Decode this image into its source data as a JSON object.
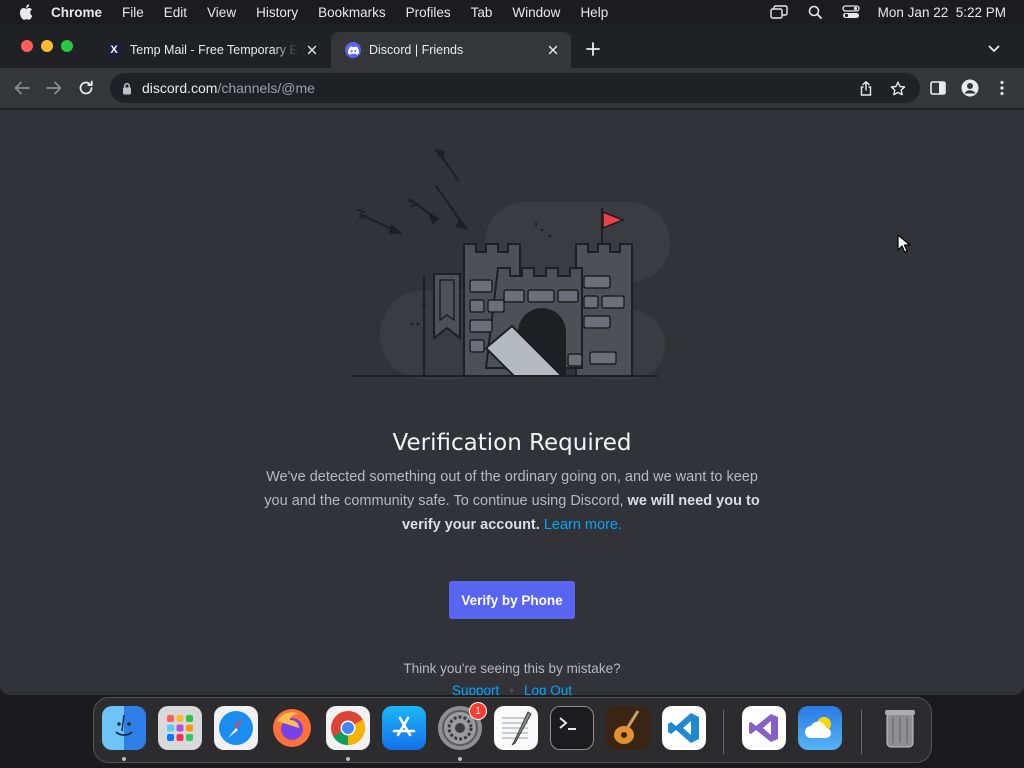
{
  "menubar": {
    "app_name": "Chrome",
    "items": [
      "File",
      "Edit",
      "View",
      "History",
      "Bookmarks",
      "Profiles",
      "Tab",
      "Window",
      "Help"
    ],
    "datetime": "Mon Jan 22  5:22 PM"
  },
  "tabs": [
    {
      "title": "Temp Mail - Free Temporary E",
      "favicon_text": "X",
      "active": false
    },
    {
      "title": "Discord | Friends",
      "active": true
    }
  ],
  "address_bar": {
    "host": "discord.com",
    "path": "/channels/@me"
  },
  "page": {
    "heading": "Verification Required",
    "description_part1": "We've detected something out of the ordinary going on, and we want to keep you and the community safe. To continue using Discord,",
    "description_bold": "we will need you to verify your account.",
    "learn_more": "Learn more.",
    "verify_button": "Verify by Phone",
    "mistake_text": "Think you're seeing this by mistake?",
    "support_link": "Support",
    "logout_link": "Log Out"
  },
  "dock": {
    "apps": [
      "finder-icon",
      "launchpad-icon",
      "safari-icon",
      "firefox-icon",
      "chrome-icon",
      "app-store-icon",
      "system-settings-icon",
      "textedit-icon",
      "terminal-icon",
      "garageband-icon",
      "vscode-icon",
      "visual-studio-icon",
      "weather-icon",
      "trash-icon"
    ],
    "settings_badge": "1"
  },
  "colors": {
    "discord_blurple": "#5865f2",
    "link_blue": "#00a8fc",
    "page_bg": "#313338"
  }
}
